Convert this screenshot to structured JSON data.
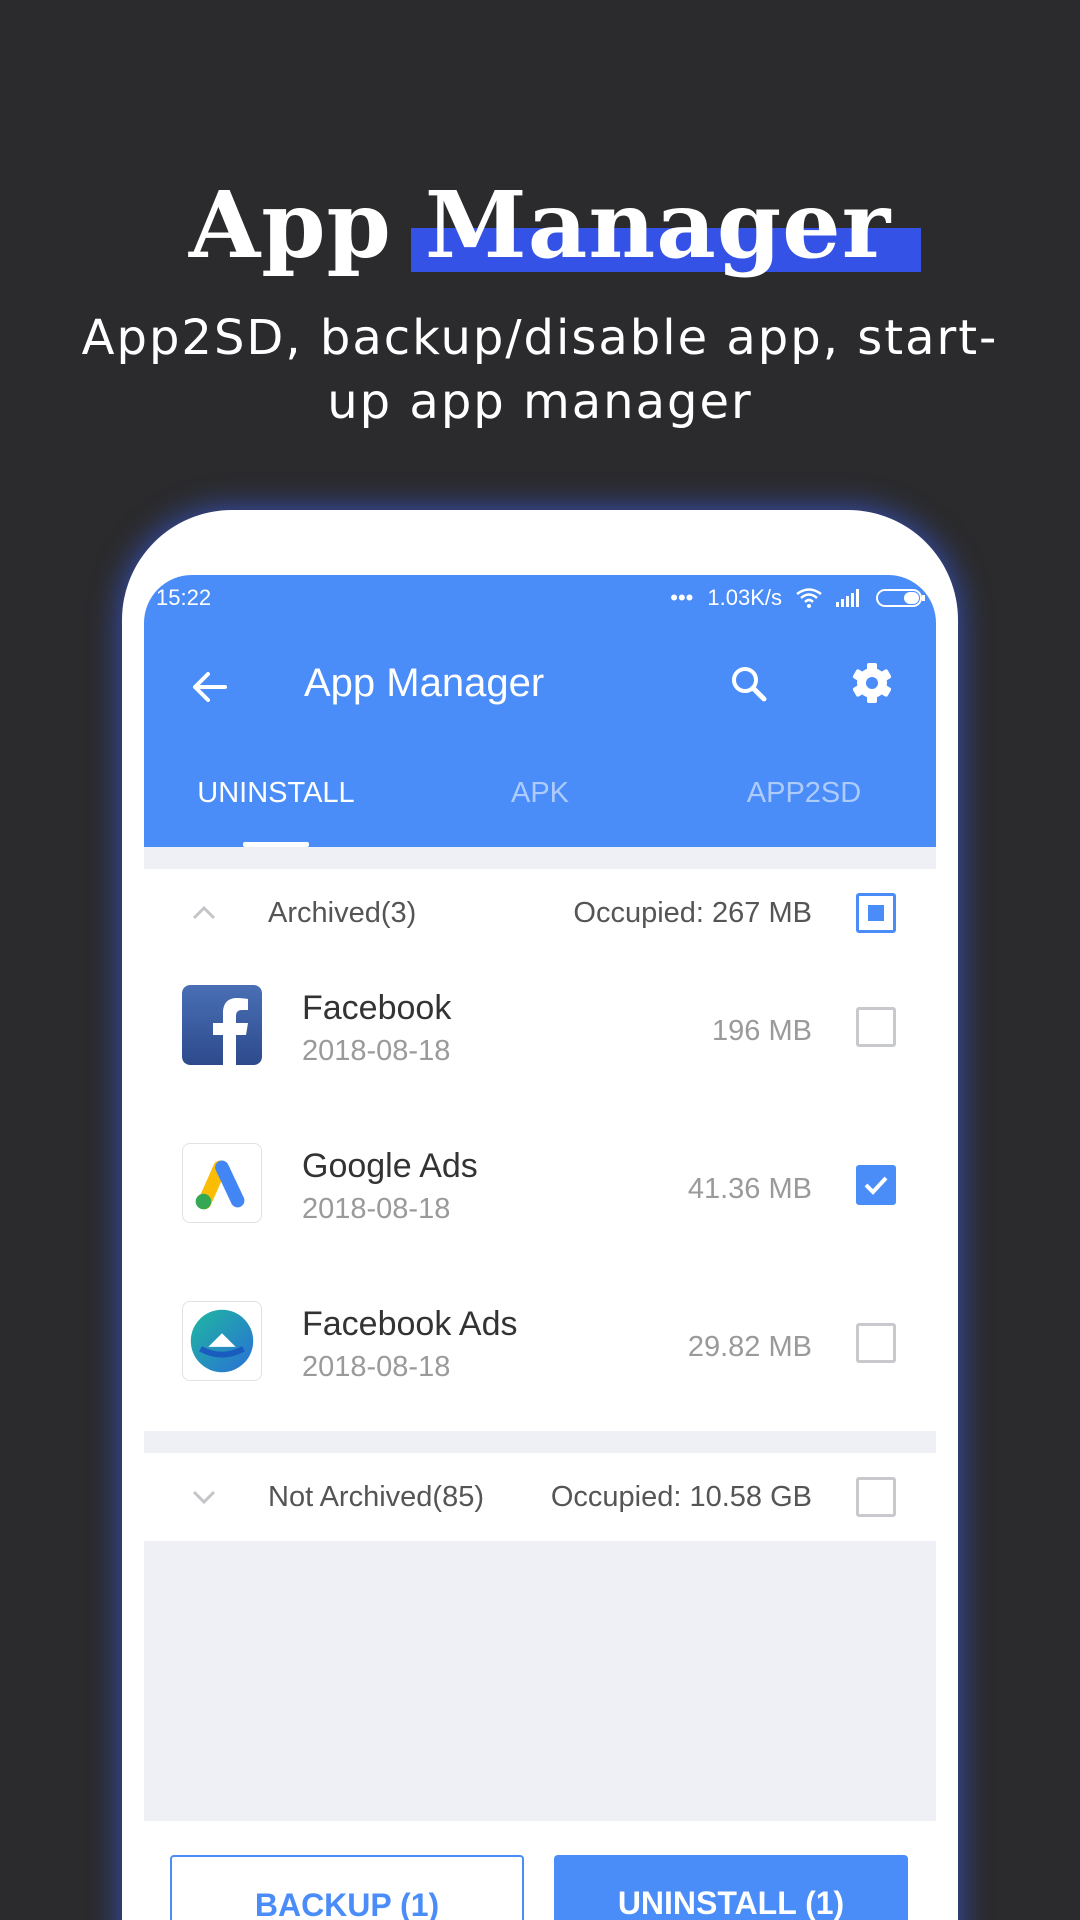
{
  "promo": {
    "title_part1": "App ",
    "title_part2": "Manager",
    "subtitle": "App2SD, backup/disable app, start-up app manager"
  },
  "status_bar": {
    "time": "15:22",
    "net_speed": "1.03K/s"
  },
  "toolbar": {
    "title": "App Manager"
  },
  "tabs": [
    "UNINSTALL",
    "APK",
    "APP2SD"
  ],
  "groups": {
    "archived": {
      "name": "Archived(3)",
      "occupied": "Occupied: 267 MB",
      "expanded": true,
      "checkbox_state": "partial"
    },
    "not_archived": {
      "name": "Not Archived(85)",
      "occupied": "Occupied: 10.58 GB",
      "expanded": false,
      "checkbox_state": "unchecked"
    }
  },
  "apps": [
    {
      "name": "Facebook",
      "date": "2018-08-18",
      "size": "196 MB",
      "checked": false,
      "icon": "facebook-icon"
    },
    {
      "name": "Google Ads",
      "date": "2018-08-18",
      "size": "41.36 MB",
      "checked": true,
      "icon": "google-ads-icon"
    },
    {
      "name": "Facebook Ads",
      "date": "2018-08-18",
      "size": "29.82 MB",
      "checked": false,
      "icon": "facebook-ads-icon"
    }
  ],
  "buttons": {
    "backup": "BACKUP (1)",
    "uninstall": "UNINSTALL (1)"
  },
  "colors": {
    "accent": "#4a8cf8",
    "highlight": "#3452e6",
    "background": "#2b2b2d"
  }
}
